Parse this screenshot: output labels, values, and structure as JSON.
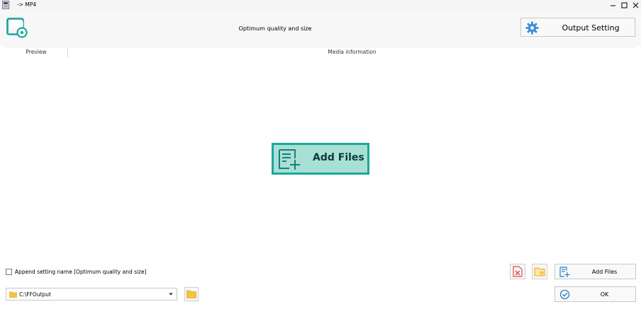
{
  "window": {
    "title": "-> MP4",
    "minimize_glyph": "—",
    "maximize_glyph": "☐",
    "close_glyph": "✕"
  },
  "toolbar": {
    "quality_label": "Optimum quality and size",
    "output_setting_label": "Output Setting"
  },
  "list": {
    "columns": [
      "Preview",
      "Media information"
    ]
  },
  "drop_zone": {
    "add_files_label": "Add Files"
  },
  "bottom": {
    "append_label": "Append setting name [Optimum quality and size]",
    "append_checked": false,
    "add_files_label": "Add Files",
    "ok_label": "OK",
    "output_path": "C:\\FFOutput"
  },
  "colors": {
    "accent": "#1aa89b",
    "accent_light": "#a8e0d6",
    "gear_blue": "#3b8fd6",
    "delete_red": "#e04848",
    "folder_yellow": "#f2b632"
  }
}
